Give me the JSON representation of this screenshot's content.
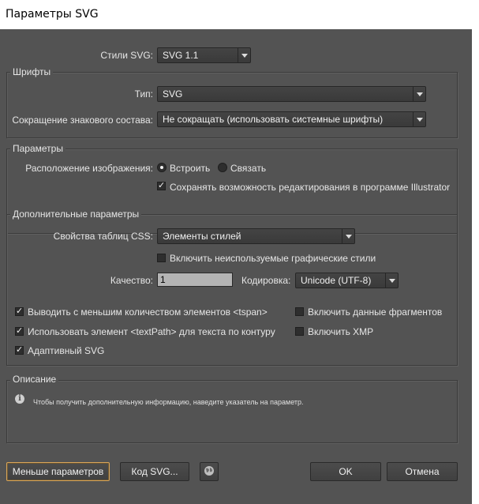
{
  "window": {
    "title": "Параметры SVG"
  },
  "svg_styles": {
    "label": "Стили SVG:",
    "value": "SVG 1.1"
  },
  "fonts_group": {
    "title": "Шрифты",
    "type_label": "Тип:",
    "type_value": "SVG",
    "subset_label": "Сокращение знакового состава:",
    "subset_value": "Не сокращать (использовать системные шрифты)"
  },
  "options_group": {
    "title": "Параметры",
    "image_location_label": "Расположение изображения:",
    "embed_label": "Встроить",
    "link_label": "Связать",
    "preserve_label": "Сохранять возможность редактирования в программе Illustrator"
  },
  "advanced_group": {
    "title": "Дополнительные параметры",
    "css_label": "Свойства таблиц CSS:",
    "css_value": "Элементы стилей",
    "unused_styles_label": "Включить неиспользуемые графические стили",
    "quality_label": "Качество:",
    "quality_value": "1",
    "encoding_label": "Кодировка:",
    "encoding_value": "Unicode (UTF-8)",
    "tspan_label": "Выводить с меньшим количеством элементов <tspan>",
    "textpath_label": "Использовать элемент <textPath> для текста по контуру",
    "responsive_label": "Адаптивный SVG",
    "slicing_label": "Включить данные фрагментов",
    "xmp_label": "Включить XMP"
  },
  "description_group": {
    "title": "Описание",
    "text": "Чтобы получить дополнительную информацию, наведите указатель на параметр."
  },
  "buttons": {
    "fewer_options": "Меньше параметров",
    "svg_code": "Код SVG...",
    "ok": "OK",
    "cancel": "Отмена"
  },
  "states": {
    "embed_selected": true,
    "preserve_checked": true,
    "unused_styles_checked": false,
    "tspan_checked": true,
    "textpath_checked": true,
    "responsive_checked": true,
    "slicing_checked": false,
    "xmp_checked": false
  },
  "icons": {
    "info": "info-icon",
    "web": "globe-icon",
    "dropdown": "dropdown-arrow-icon",
    "check": "checkmark"
  }
}
